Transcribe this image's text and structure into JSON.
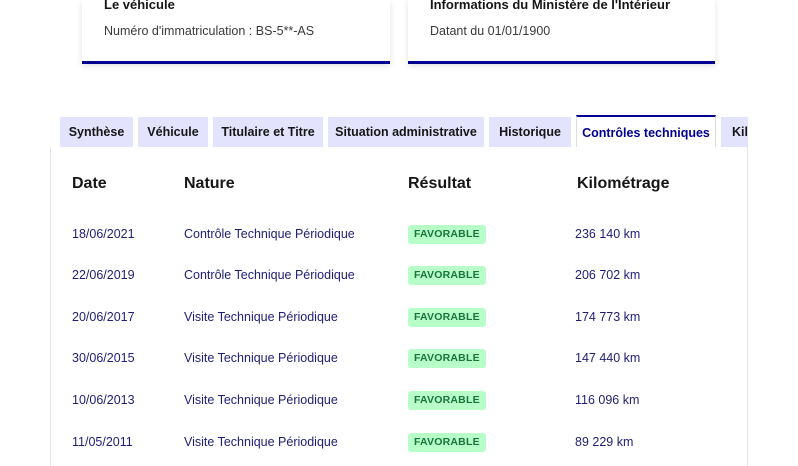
{
  "cards": {
    "vehicle": {
      "title": "Le véhicule",
      "subtitle": "Numéro d'immatriculation : BS-5**-AS"
    },
    "ministry": {
      "title": "Informations du Ministère de l'Intérieur",
      "subtitle": "Datant du 01/01/1900"
    }
  },
  "tabs": [
    {
      "label": "Synthèse"
    },
    {
      "label": "Véhicule"
    },
    {
      "label": "Titulaire et Titre"
    },
    {
      "label": "Situation administrative"
    },
    {
      "label": "Historique"
    },
    {
      "label": "Contrôles techniques"
    },
    {
      "label": "Kilométrage"
    }
  ],
  "active_tab": "Contrôles techniques",
  "table": {
    "headers": {
      "date": "Date",
      "nature": "Nature",
      "result": "Résultat",
      "mileage": "Kilométrage"
    },
    "rows": [
      {
        "date": "18/06/2021",
        "nature": "Contrôle Technique Périodique",
        "result": "FAVORABLE",
        "mileage": "236 140 km"
      },
      {
        "date": "22/06/2019",
        "nature": "Contrôle Technique Périodique",
        "result": "FAVORABLE",
        "mileage": "206 702 km"
      },
      {
        "date": "20/06/2017",
        "nature": "Visite Technique Périodique",
        "result": "FAVORABLE",
        "mileage": "174 773 km"
      },
      {
        "date": "30/06/2015",
        "nature": "Visite Technique Périodique",
        "result": "FAVORABLE",
        "mileage": "147 440 km"
      },
      {
        "date": "10/06/2013",
        "nature": "Visite Technique Périodique",
        "result": "FAVORABLE",
        "mileage": "116 096 km"
      },
      {
        "date": "11/05/2011",
        "nature": "Visite Technique Périodique",
        "result": "FAVORABLE",
        "mileage": "89 229 km"
      }
    ]
  },
  "colors": {
    "accent": "#000091",
    "tab_background": "#e3e3fd",
    "badge_background": "#b8fec9",
    "badge_text": "#18753c",
    "link_text": "#1e1e78"
  }
}
